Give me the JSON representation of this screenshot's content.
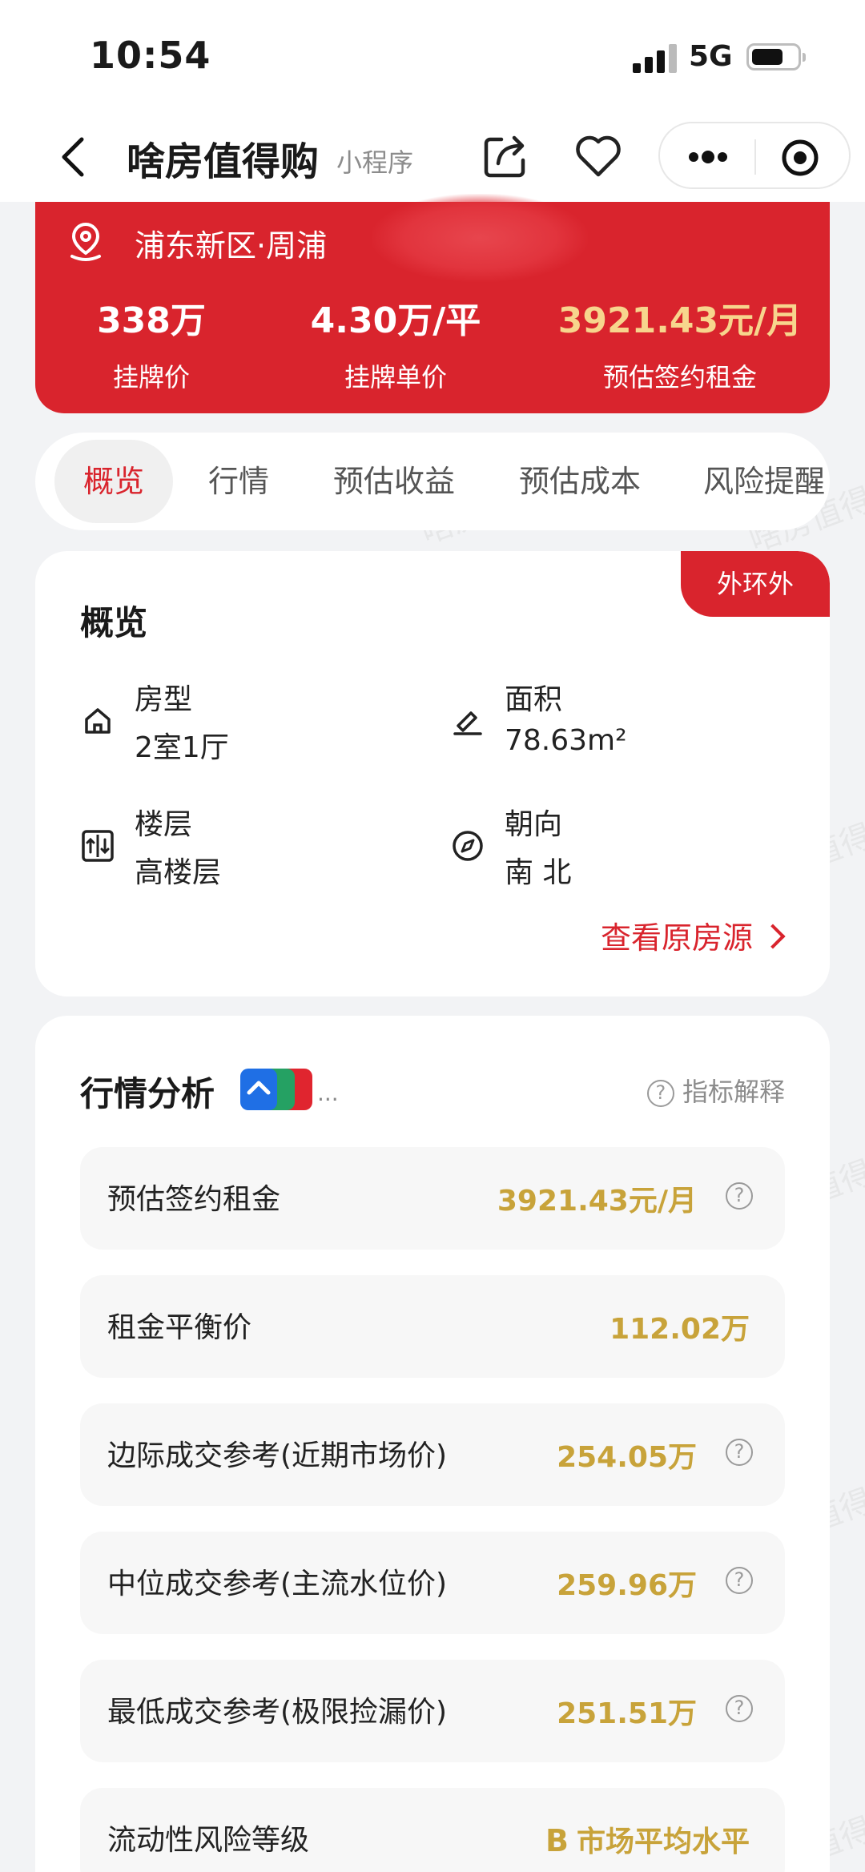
{
  "status_bar": {
    "time": "10:54",
    "network": "5G"
  },
  "nav": {
    "title": "啥房值得购",
    "subtitle": "小程序"
  },
  "summary": {
    "location": "浦东新区·周浦",
    "price": {
      "value": "338万",
      "label": "挂牌价"
    },
    "unit_price": {
      "value": "4.30万/平",
      "label": "挂牌单价"
    },
    "rent": {
      "value": "3921.43元/月",
      "label": "预估签约租金"
    }
  },
  "tabs": [
    {
      "label": "概览",
      "active": true
    },
    {
      "label": "行情"
    },
    {
      "label": "预估收益"
    },
    {
      "label": "预估成本"
    },
    {
      "label": "风险提醒"
    }
  ],
  "overview": {
    "title": "概览",
    "badge": "外环外",
    "items": [
      {
        "label": "房型",
        "value": "2室1厅",
        "icon": "house-icon"
      },
      {
        "label": "面积",
        "value": "78.63m²",
        "icon": "ruler-icon"
      },
      {
        "label": "楼层",
        "value": "高楼层",
        "icon": "floor-icon"
      },
      {
        "label": "朝向",
        "value": "南 北",
        "icon": "compass-icon"
      }
    ],
    "view_source": "查看原房源"
  },
  "market": {
    "title": "行情分析",
    "badge_more": "...",
    "explain": "指标解释",
    "rows": [
      {
        "label": "预估签约租金",
        "value": "3921.43元/月",
        "help": true
      },
      {
        "label": "租金平衡价",
        "value": "112.02万",
        "help": false
      },
      {
        "label": "边际成交参考(近期市场价)",
        "value": "254.05万",
        "help": true
      },
      {
        "label": "中位成交参考(主流水位价)",
        "value": "259.96万",
        "help": true
      },
      {
        "label": "最低成交参考(极限捡漏价)",
        "value": "251.51万",
        "help": true
      },
      {
        "label": "流动性风险等级",
        "grade": "B",
        "value": "市场平均水平",
        "help": false
      }
    ]
  },
  "watermark_text": "啥房值得购",
  "colors": {
    "brand_red": "#d9242d",
    "gold": "#c8a33a",
    "rent_gold": "#f7d58d"
  }
}
